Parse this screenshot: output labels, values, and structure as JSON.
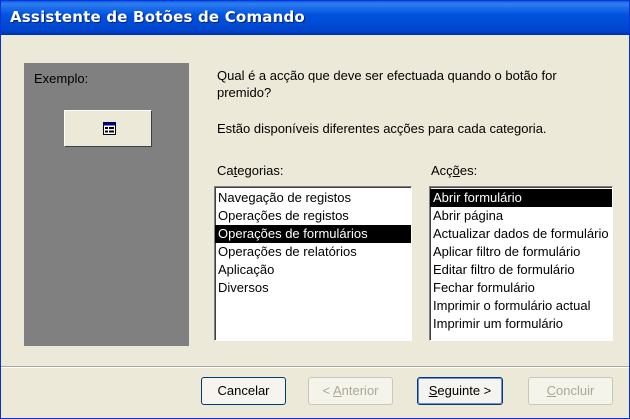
{
  "window": {
    "title": "Assistente de Botões de Comando"
  },
  "example": {
    "label": "Exemplo:",
    "button_icon": "form-icon"
  },
  "question": "Qual é a acção que deve ser efectuada quando o botão for premido?",
  "info": "Estão disponíveis diferentes acções para cada categoria.",
  "categories": {
    "label_before": "Ca",
    "label_hotkey": "t",
    "label_after": "egorias:",
    "items": [
      "Navegação de registos",
      "Operações de registos",
      "Operações de formulários",
      "Operações de relatórios",
      "Aplicação",
      "Diversos"
    ],
    "selected": "Operações de formulários"
  },
  "actions": {
    "label_before": "Acç",
    "label_hotkey": "õ",
    "label_after": "es:",
    "items": [
      "Abrir formulário",
      "Abrir página",
      "Actualizar dados de formulário",
      "Aplicar filtro de formulário",
      "Editar filtro de formulário",
      "Fechar formulário",
      "Imprimir o formulário actual",
      "Imprimir um formulário"
    ],
    "selected": "Abrir formulário"
  },
  "buttons": {
    "cancel": "Cancelar",
    "back_prefix": "< ",
    "back_hotkey": "A",
    "back_rest": "nterior",
    "next_hotkey": "S",
    "next_rest": "eguinte >",
    "finish_hotkey": "C",
    "finish_rest": "oncluir"
  },
  "colors": {
    "title_bar": "#0054e3",
    "panel": "#808080",
    "dialog_bg": "#ece9d8",
    "selection": "#000000"
  }
}
